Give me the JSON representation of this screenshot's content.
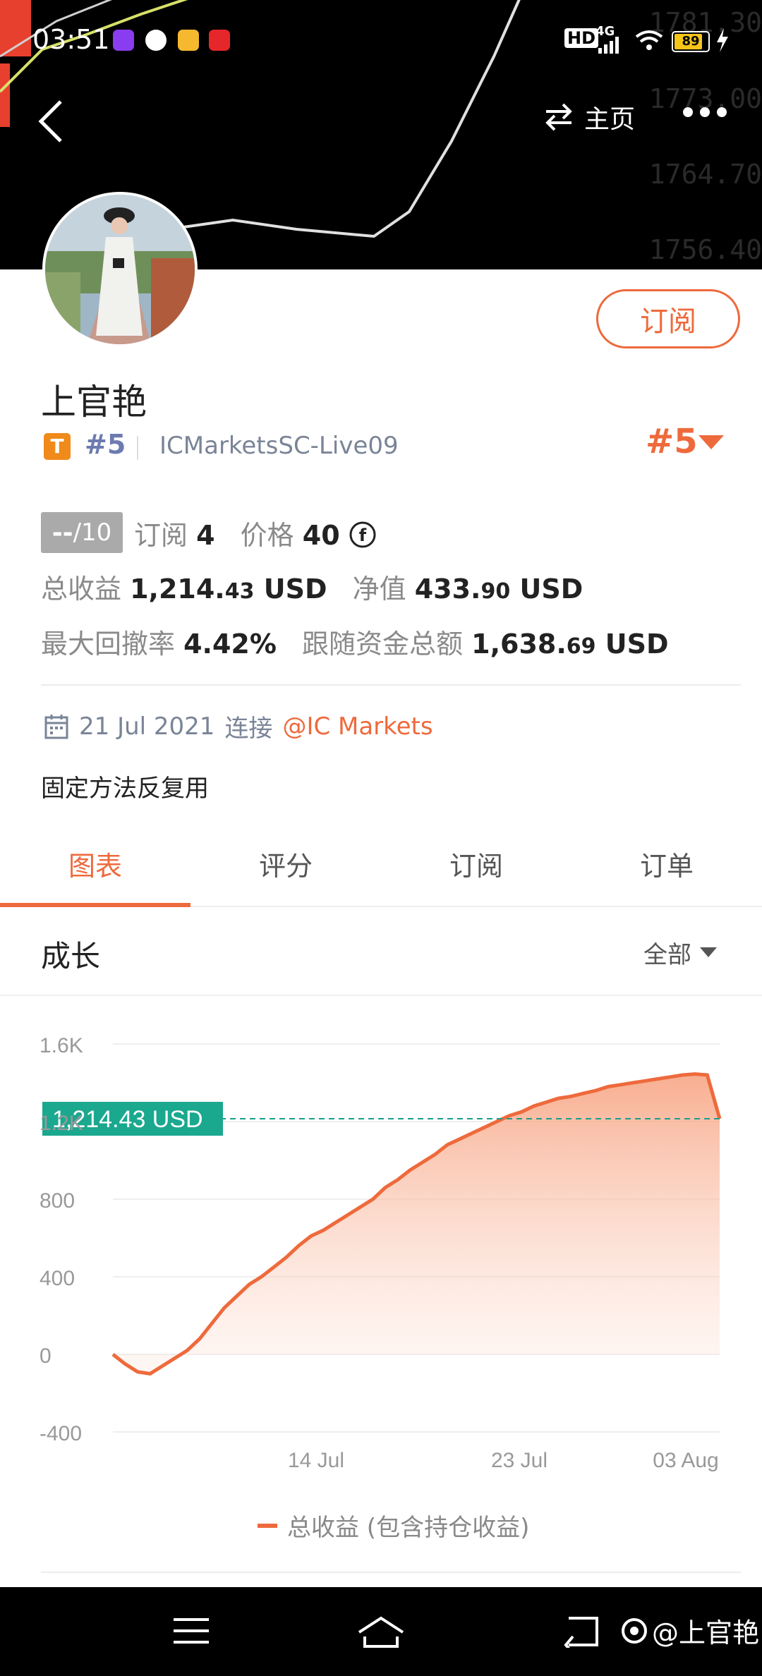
{
  "status_bar": {
    "time": "03:51",
    "network": "4G",
    "hd": "HD",
    "battery": "89",
    "battery_level": 0.89,
    "app_icons": [
      "podcast-icon",
      "chat-icon",
      "mail-icon",
      "weibo-icon"
    ]
  },
  "header": {
    "background_price_labels": [
      "1781.30",
      "1773.00",
      "1764.70",
      "1756.40"
    ],
    "home_label": "主页"
  },
  "profile": {
    "name": "上官艳",
    "tag": "T",
    "rank_small": "#5",
    "server": "ICMarketsSC-Live09",
    "rank_big": "#5",
    "subscribe_label": "订阅"
  },
  "stats": {
    "score_value": "--",
    "score_max": "/10",
    "subscribe_label": "订阅",
    "subscribe_count": "4",
    "price_label": "价格",
    "price_value": "40",
    "total_profit_label": "总收益",
    "total_profit_int": "1,214.",
    "total_profit_dec": "43",
    "total_profit_unit": "USD",
    "equity_label": "净值",
    "equity_int": "433.",
    "equity_dec": "90",
    "equity_unit": "USD",
    "max_dd_label": "最大回撤率",
    "max_dd_value": "4.42%",
    "follow_label": "跟随资金总额",
    "follow_int": "1,638.",
    "follow_dec": "69",
    "follow_unit": "USD"
  },
  "connection": {
    "date": "21 Jul 2021",
    "connect_label": "连接",
    "broker": "@IC Markets"
  },
  "description": "固定方法反复用",
  "tabs": [
    {
      "label": "图表",
      "active": true
    },
    {
      "label": "评分",
      "active": false
    },
    {
      "label": "订阅",
      "active": false
    },
    {
      "label": "订单",
      "active": false
    }
  ],
  "growth": {
    "title": "成长",
    "range": "全部"
  },
  "chart_data": {
    "type": "area",
    "title": "",
    "xlabel": "",
    "ylabel": "",
    "ylim": [
      -400,
      1600
    ],
    "y_ticks": [
      "1.6K",
      "1.2K",
      "800",
      "400",
      "0",
      "-400"
    ],
    "x_ticks": [
      "14 Jul",
      "23 Jul",
      "03 Aug"
    ],
    "current_value_label": "1,214.43 USD",
    "current_value": 1214.43,
    "line_color": "#ee6a3c",
    "series": [
      {
        "name": "总收益 (包含持仓收益)",
        "values": [
          0,
          -50,
          -90,
          -100,
          -60,
          -20,
          20,
          80,
          160,
          240,
          300,
          360,
          400,
          450,
          500,
          560,
          610,
          640,
          680,
          720,
          760,
          800,
          860,
          900,
          950,
          990,
          1030,
          1080,
          1110,
          1140,
          1170,
          1200,
          1230,
          1250,
          1280,
          1300,
          1320,
          1330,
          1345,
          1360,
          1380,
          1390,
          1400,
          1410,
          1420,
          1430,
          1440,
          1445,
          1440,
          1214.43
        ]
      }
    ]
  },
  "watermark": "@上官艳"
}
